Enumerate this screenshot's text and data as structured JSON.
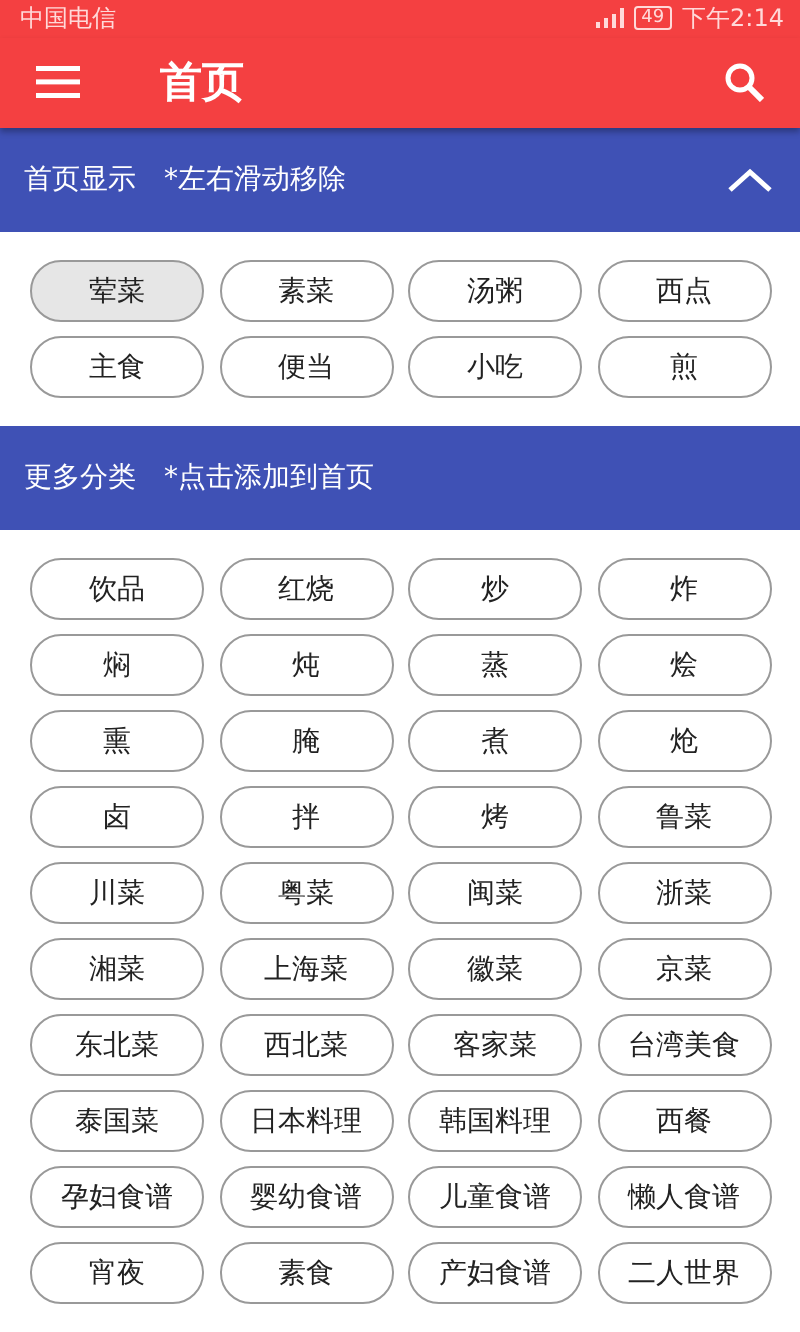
{
  "status_bar": {
    "carrier": "中国电信",
    "battery": "49",
    "time": "下午2:14"
  },
  "app_bar": {
    "title": "首页"
  },
  "home_section": {
    "title": "首页显示",
    "hint": "*左右滑动移除",
    "expanded": true,
    "items": [
      {
        "label": "荤菜",
        "selected": true
      },
      {
        "label": "素菜",
        "selected": false
      },
      {
        "label": "汤粥",
        "selected": false
      },
      {
        "label": "西点",
        "selected": false
      },
      {
        "label": "主食",
        "selected": false
      },
      {
        "label": "便当",
        "selected": false
      },
      {
        "label": "小吃",
        "selected": false
      },
      {
        "label": "煎",
        "selected": false
      }
    ]
  },
  "more_section": {
    "title": "更多分类",
    "hint": "*点击添加到首页",
    "items": [
      "饮品",
      "红烧",
      "炒",
      "炸",
      "焖",
      "炖",
      "蒸",
      "烩",
      "熏",
      "腌",
      "煮",
      "炝",
      "卤",
      "拌",
      "烤",
      "鲁菜",
      "川菜",
      "粤菜",
      "闽菜",
      "浙菜",
      "湘菜",
      "上海菜",
      "徽菜",
      "京菜",
      "东北菜",
      "西北菜",
      "客家菜",
      "台湾美食",
      "泰国菜",
      "日本料理",
      "韩国料理",
      "西餐",
      "孕妇食谱",
      "婴幼食谱",
      "儿童食谱",
      "懒人食谱",
      "宵夜",
      "素食",
      "产妇食谱",
      "二人世界"
    ]
  }
}
